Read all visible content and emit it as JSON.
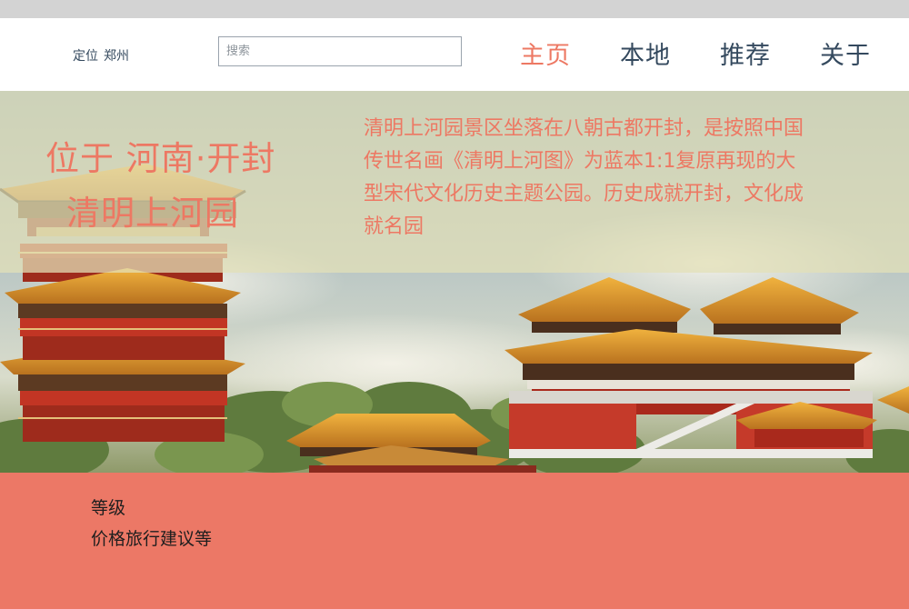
{
  "header": {
    "location_label": "定位",
    "location_city": "郑州",
    "search": {
      "placeholder": "搜索"
    },
    "nav": [
      {
        "label": "主页",
        "active": true
      },
      {
        "label": "本地",
        "active": false
      },
      {
        "label": "推荐",
        "active": false
      },
      {
        "label": "关于",
        "active": false
      }
    ]
  },
  "hero": {
    "title": "位于 河南·开封",
    "subtitle": "清明上河园",
    "description": "清明上河园景区坐落在八朝古都开封，是按照中国传世名画《清明上河图》为蓝本1:1复原再现的大型宋代文化历史主题公园。历史成就开封，文化成就名园"
  },
  "footer": {
    "lines": [
      "等级",
      "价格旅行建议等"
    ]
  },
  "colors": {
    "accent": "#ed7863",
    "nav_text": "#34495e",
    "footer_bg": "#ec7866",
    "top_strip": "#d3d3d3"
  }
}
